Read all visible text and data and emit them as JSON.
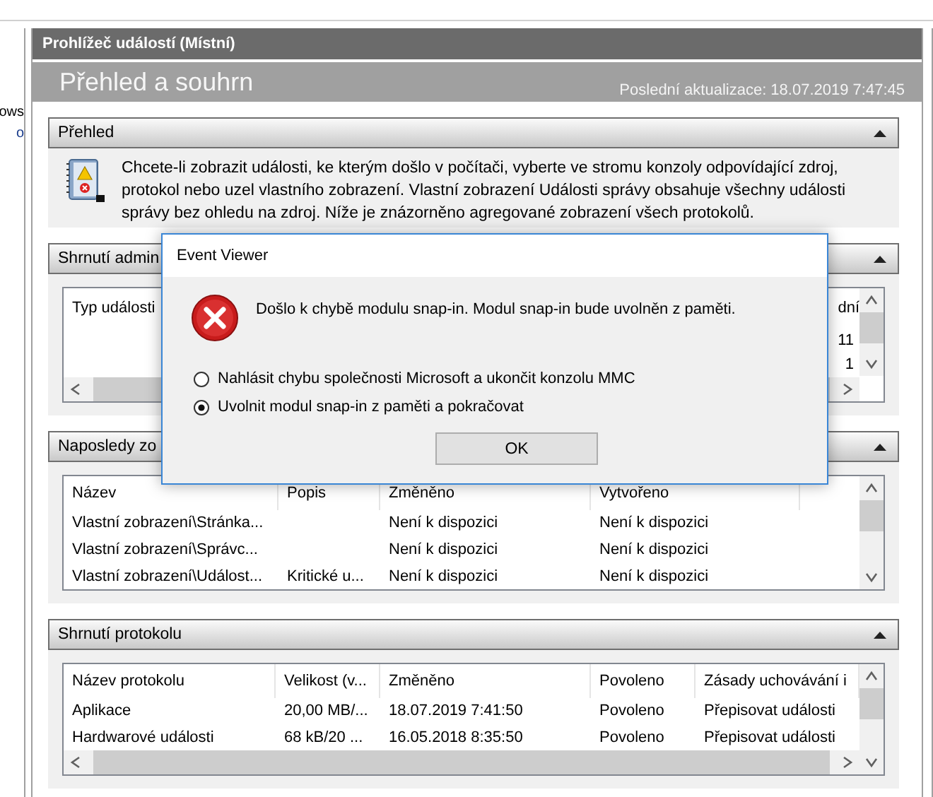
{
  "left_pane": {
    "items": [
      "ows",
      "o"
    ]
  },
  "console": {
    "title": "Prohlížeč událostí (Místní)",
    "heading": "Přehled a souhrn",
    "last_update": "Poslední aktualizace: 18.07.2019 7:47:45"
  },
  "sections": [
    {
      "kind": "text",
      "title": "Přehled",
      "expanded": true,
      "text": "Chcete-li zobrazit události, ke kterým došlo v počítači, vyberte ve stromu konzoly odpovídající zdroj, protokol nebo uzel vlastního zobrazení. Vlastní zobrazení Události správy obsahuje všechny události správy bez ohledu na zdroj. Níže je znázorněno agregované zobrazení všech protokolů."
    },
    {
      "kind": "table",
      "title": "Shrnutí admin",
      "expanded": true,
      "columns": [
        "Typ události",
        "dní"
      ],
      "rows": [
        [
          "11"
        ],
        [
          "1"
        ]
      ]
    },
    {
      "kind": "table",
      "title": "Naposledy zo",
      "expanded": true,
      "columns": [
        "Název",
        "Popis",
        "Změněno",
        "Vytvořeno"
      ],
      "rows": [
        [
          "Vlastní zobrazení\\Stránka...",
          "",
          "Není k dispozici",
          "Není k dispozici"
        ],
        [
          "Vlastní zobrazení\\Správc...",
          "",
          "Není k dispozici",
          "Není k dispozici"
        ],
        [
          "Vlastní zobrazení\\Událost...",
          "Kritické u...",
          "Není k dispozici",
          "Není k dispozici"
        ]
      ]
    },
    {
      "kind": "table",
      "title": "Shrnutí protokolu",
      "expanded": true,
      "columns": [
        "Název protokolu",
        "Velikost (v...",
        "Změněno",
        "Povoleno",
        "Zásady uchovávání i"
      ],
      "rows": [
        [
          "Aplikace",
          "20,00 MB/...",
          "18.07.2019 7:41:50",
          "Povoleno",
          "Přepisovat události"
        ],
        [
          "Hardwarové události",
          "68 kB/20 ...",
          "16.05.2018 8:35:50",
          "Povoleno",
          "Přepisovat události"
        ]
      ]
    }
  ],
  "dialog": {
    "title": "Event Viewer",
    "message": "Došlo k chybě modulu snap-in. Modul snap-in bude uvolněn z paměti.",
    "options": [
      {
        "label": "Nahlásit chybu společnosti Microsoft a ukončit konzolu MMC",
        "selected": false
      },
      {
        "label": "Uvolnit modul snap-in z paměti a pokračovat",
        "selected": true
      }
    ],
    "button": "OK"
  }
}
